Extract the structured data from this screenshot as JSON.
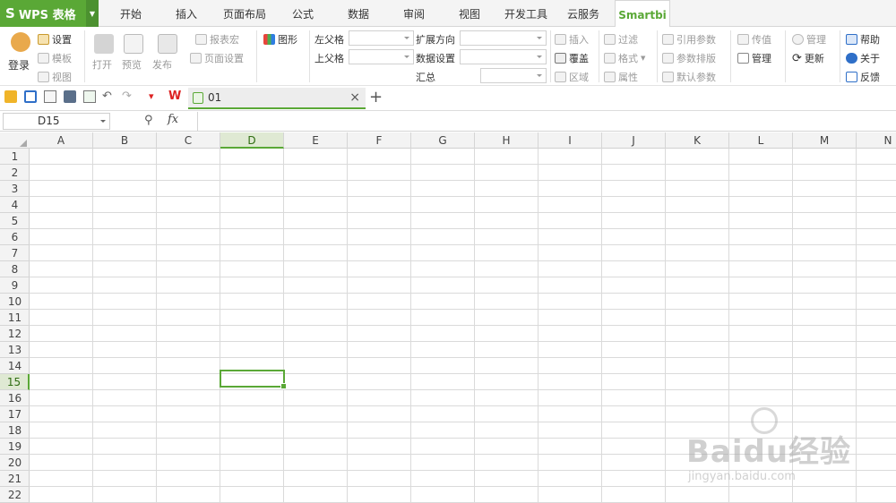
{
  "app": {
    "logo_letter": "S",
    "name": "WPS 表格"
  },
  "tabs": [
    "开始",
    "插入",
    "页面布局",
    "公式",
    "数据",
    "审阅",
    "视图",
    "开发工具",
    "云服务",
    "Smartbi"
  ],
  "active_tab": "Smartbi",
  "ribbon": {
    "login": "登录",
    "settings": "设置",
    "template": "模板",
    "view": "视图",
    "open": "打开",
    "preview": "预览",
    "publish": "发布",
    "report_macro": "报表宏",
    "page_setup": "页面设置",
    "chart": "图形",
    "left_parent": "左父格",
    "top_parent": "上父格",
    "expand_dir": "扩展方向",
    "data_settings": "数据设置",
    "summary": "汇总",
    "insert": "插入",
    "cover": "覆盖",
    "region": "区域",
    "filter": "过滤",
    "format": "格式",
    "attribute": "属性",
    "ref_param": "引用参数",
    "param_layout": "参数排版",
    "default_param": "默认参数",
    "pass_value": "传值",
    "manage": "管理",
    "manage2": "管理",
    "update": "更新",
    "help": "帮助",
    "about": "关于",
    "feedback": "反馈"
  },
  "doc_tab": {
    "name": "01",
    "close": "×",
    "add": "+"
  },
  "formula_bar": {
    "cell_ref": "D15",
    "fx": "fx",
    "formula": ""
  },
  "columns": [
    "A",
    "B",
    "C",
    "D",
    "E",
    "F",
    "G",
    "H",
    "I",
    "J",
    "K",
    "L",
    "M",
    "N"
  ],
  "rows": [
    "1",
    "2",
    "3",
    "4",
    "5",
    "6",
    "7",
    "8",
    "9",
    "10",
    "11",
    "12",
    "13",
    "14",
    "15",
    "16",
    "17",
    "18",
    "19",
    "20",
    "21",
    "22"
  ],
  "selected_cell": {
    "column": "D",
    "row": "15"
  },
  "watermark": {
    "brand": "Baidu经验",
    "url": "jingyan.baidu.com"
  },
  "colors": {
    "accent": "#5aa836",
    "tab_bg": "#f4f4f4",
    "grid": "#dadada"
  }
}
